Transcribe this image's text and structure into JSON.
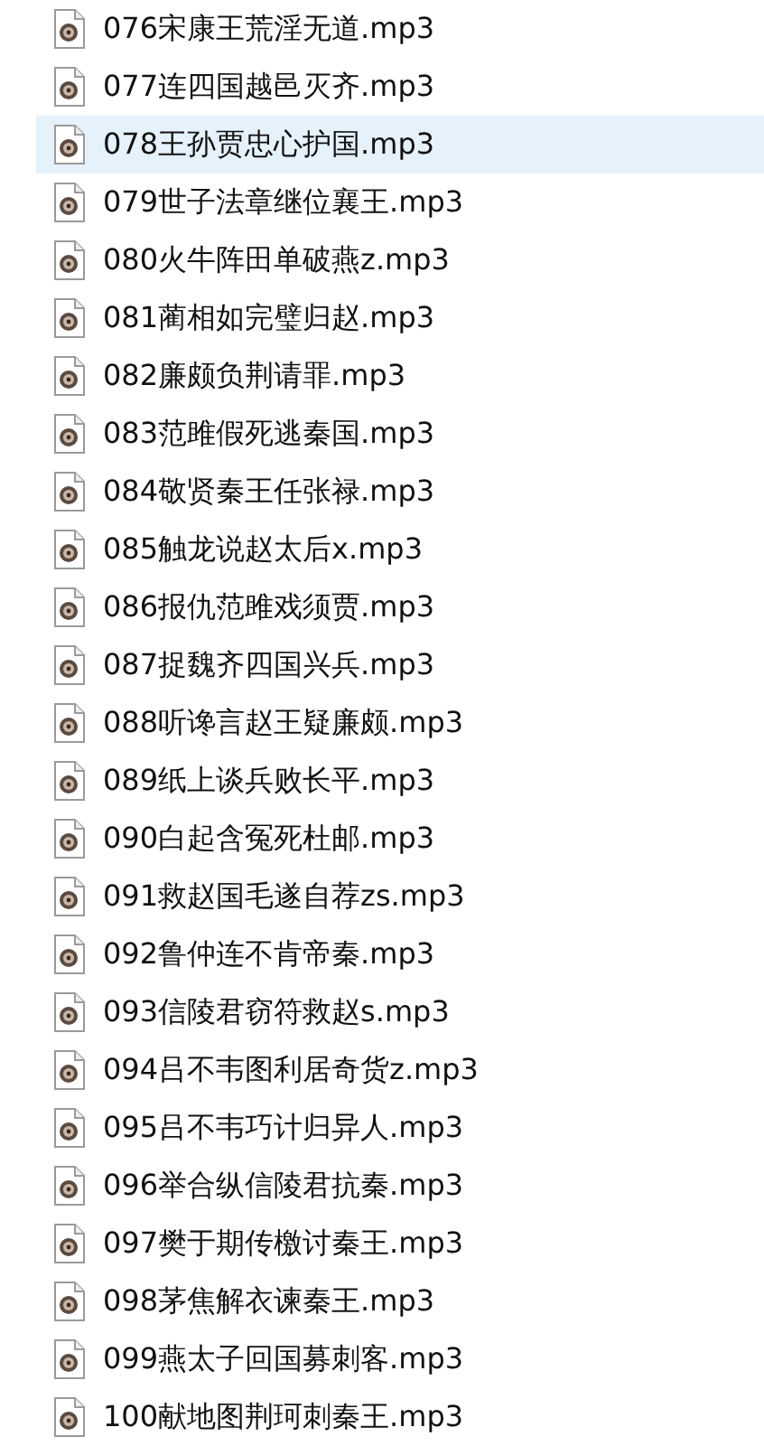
{
  "files": [
    {
      "name": "076宋康王荒淫无道.mp3",
      "selected": false
    },
    {
      "name": "077连四国越邑灭齐.mp3",
      "selected": false
    },
    {
      "name": "078王孙贾忠心护国.mp3",
      "selected": true
    },
    {
      "name": "079世子法章继位襄王.mp3",
      "selected": false
    },
    {
      "name": "080火牛阵田单破燕z.mp3",
      "selected": false
    },
    {
      "name": "081蔺相如完璧归赵.mp3",
      "selected": false
    },
    {
      "name": "082廉颇负荆请罪.mp3",
      "selected": false
    },
    {
      "name": "083范雎假死逃秦国.mp3",
      "selected": false
    },
    {
      "name": "084敬贤秦王任张禄.mp3",
      "selected": false
    },
    {
      "name": "085触龙说赵太后x.mp3",
      "selected": false
    },
    {
      "name": "086报仇范雎戏须贾.mp3",
      "selected": false
    },
    {
      "name": "087捉魏齐四国兴兵.mp3",
      "selected": false
    },
    {
      "name": "088听谗言赵王疑廉颇.mp3",
      "selected": false
    },
    {
      "name": "089纸上谈兵败长平.mp3",
      "selected": false
    },
    {
      "name": "090白起含冤死杜邮.mp3",
      "selected": false
    },
    {
      "name": "091救赵国毛遂自荐zs.mp3",
      "selected": false
    },
    {
      "name": "092鲁仲连不肯帝秦.mp3",
      "selected": false
    },
    {
      "name": "093信陵君窃符救赵s.mp3",
      "selected": false
    },
    {
      "name": "094吕不韦图利居奇货z.mp3",
      "selected": false
    },
    {
      "name": "095吕不韦巧计归异人.mp3",
      "selected": false
    },
    {
      "name": "096举合纵信陵君抗秦.mp3",
      "selected": false
    },
    {
      "name": "097樊于期传檄讨秦王.mp3",
      "selected": false
    },
    {
      "name": "098茅焦解衣谏秦王.mp3",
      "selected": false
    },
    {
      "name": "099燕太子回国募刺客.mp3",
      "selected": false
    },
    {
      "name": "100献地图荆珂刺秦王.mp3",
      "selected": false
    }
  ]
}
